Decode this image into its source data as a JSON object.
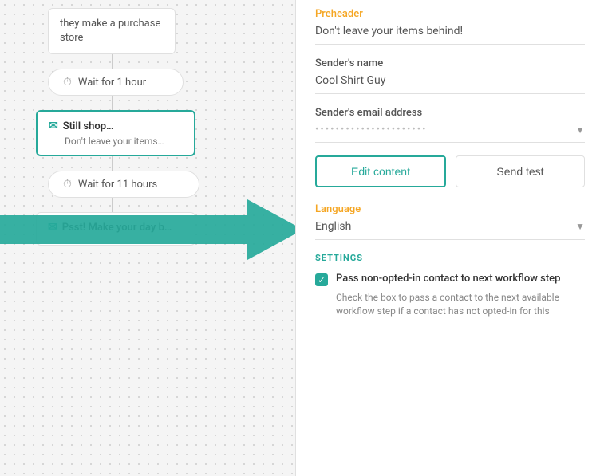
{
  "left": {
    "purchase_card": {
      "line1": "they make a purchase",
      "line2": "store"
    },
    "wait1": {
      "label": "Wait for 1 hour"
    },
    "email1": {
      "title": "Still shop…",
      "subtitle": "Don't leave your items…"
    },
    "wait2": {
      "label": "Wait for 11 hours"
    },
    "email2": {
      "title": "Psst! Make your day b…"
    }
  },
  "right": {
    "preheader": {
      "label": "Preheader",
      "value": "Don't leave your items behind!"
    },
    "senders_name": {
      "label": "Sender's name",
      "value": "Cool Shirt Guy"
    },
    "senders_email": {
      "label": "Sender's email address",
      "blurred": "••••••••••••••••••••••"
    },
    "buttons": {
      "edit": "Edit content",
      "send_test": "Send test"
    },
    "language": {
      "label": "Language",
      "value": "English"
    },
    "settings": {
      "section_label": "SETTINGS",
      "checkbox_label": "Pass non-opted-in contact to next workflow step",
      "checkbox_desc": "Check the box to pass a contact to the next available workflow step if a contact has not opted-in for this"
    }
  }
}
